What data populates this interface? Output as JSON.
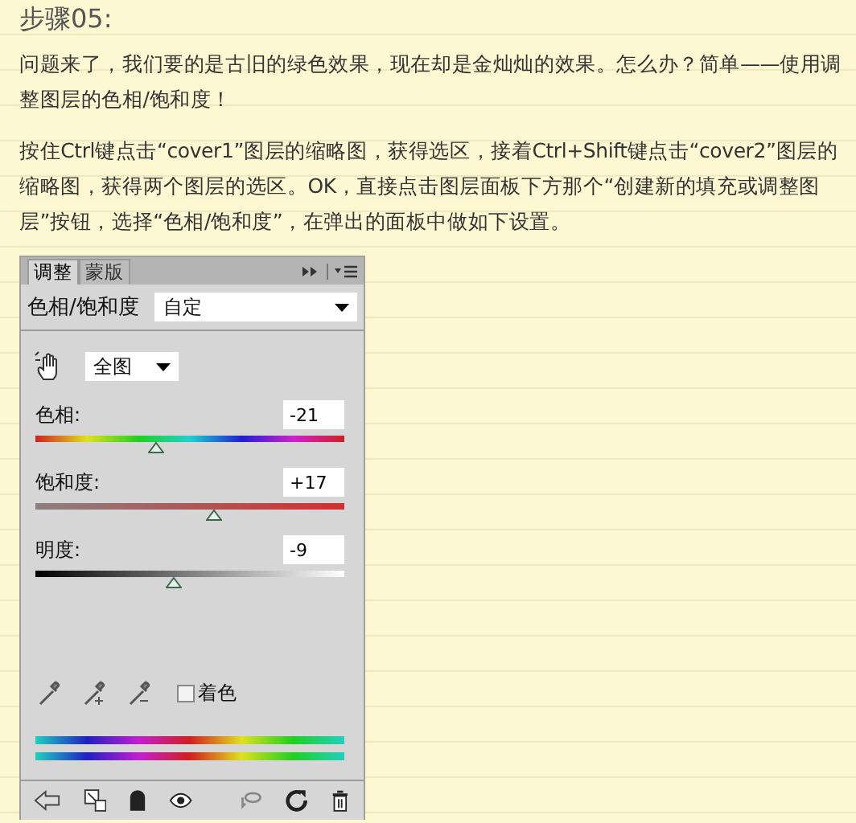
{
  "heading": "步骤05:",
  "paragraphs": [
    "问题来了，我们要的是古旧的绿色效果，现在却是金灿灿的效果。怎么办？简单——使用调整图层的色相/饱和度！",
    "按住Ctrl键点击“cover1”图层的缩略图，获得选区，接着Ctrl+Shift键点击“cover2”图层的缩略图，获得两个图层的选区。OK，直接点击图层面板下方那个“创建新的填充或调整图层”按钮，选择“色相/饱和度”，在弹出的面板中做如下设置。"
  ],
  "panel": {
    "tabs": [
      {
        "label": "调整",
        "selected": true
      },
      {
        "label": "蒙版",
        "selected": false
      }
    ],
    "preset_label": "色相/饱和度",
    "preset": "自定",
    "channel": "全图",
    "sliders": [
      {
        "kind": "hue",
        "label": "色相:",
        "value": "-21",
        "level": 0.39
      },
      {
        "kind": "saturation",
        "label": "饱和度:",
        "value": "+17",
        "level": 0.58
      },
      {
        "kind": "lightness",
        "label": "明度:",
        "value": "-9",
        "level": 0.45
      }
    ],
    "colorize": {
      "label": "着色",
      "checked": false
    }
  }
}
